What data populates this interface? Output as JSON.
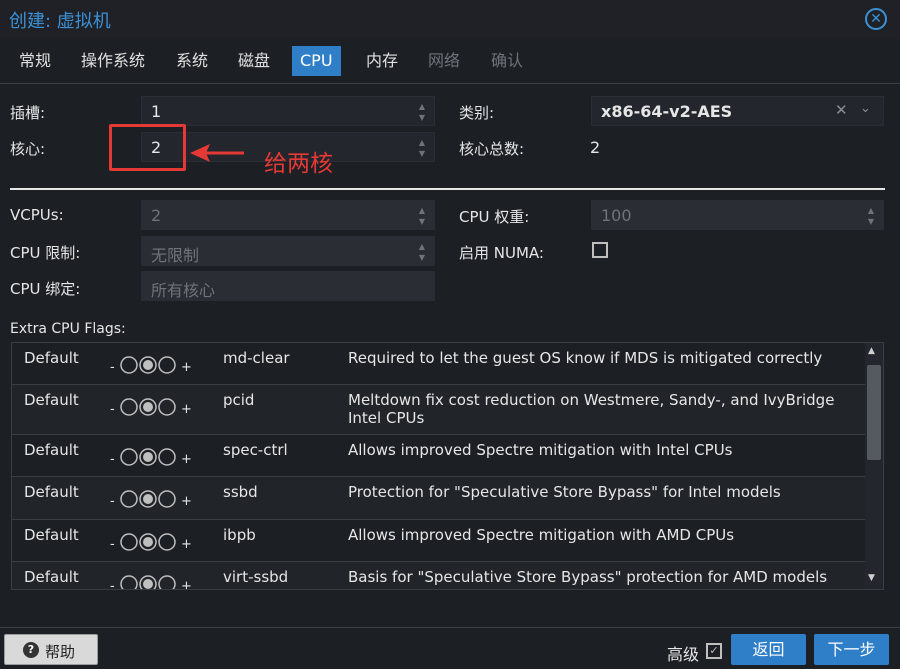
{
  "window": {
    "title": "创建: 虚拟机",
    "close_icon": "close-circle-icon"
  },
  "tabs": [
    {
      "label": "常规",
      "state": "normal"
    },
    {
      "label": "操作系统",
      "state": "normal"
    },
    {
      "label": "系统",
      "state": "normal"
    },
    {
      "label": "磁盘",
      "state": "normal"
    },
    {
      "label": "CPU",
      "state": "active"
    },
    {
      "label": "内存",
      "state": "normal"
    },
    {
      "label": "网络",
      "state": "disabled"
    },
    {
      "label": "确认",
      "state": "disabled"
    }
  ],
  "form": {
    "sockets": {
      "label": "插槽:",
      "value": "1"
    },
    "cores": {
      "label": "核心:",
      "value": "2"
    },
    "type": {
      "label": "类别:",
      "value": "x86-64-v2-AES"
    },
    "total_cores": {
      "label": "核心总数:",
      "value": "2"
    },
    "vcpus": {
      "label": "VCPUs:",
      "value": "2"
    },
    "cpu_limit": {
      "label": "CPU 限制:",
      "placeholder": "无限制"
    },
    "cpu_affinity": {
      "label": "CPU 绑定:",
      "placeholder": "所有核心"
    },
    "cpu_weight": {
      "label": "CPU 权重:",
      "placeholder": "100"
    },
    "numa": {
      "label": "启用 NUMA:",
      "checked": false
    }
  },
  "annotation": {
    "text": "给两核",
    "color": "#e53935"
  },
  "flags": {
    "label": "Extra CPU Flags:",
    "rows": [
      {
        "default": "Default",
        "minus": "-",
        "plus": "+",
        "name": "md-clear",
        "desc": "Required to let the guest OS know if MDS is mitigated correctly"
      },
      {
        "default": "Default",
        "minus": "-",
        "plus": "+",
        "name": "pcid",
        "desc": "Meltdown fix cost reduction on Westmere, Sandy-, and IvyBridge Intel CPUs"
      },
      {
        "default": "Default",
        "minus": "-",
        "plus": "+",
        "name": "spec-ctrl",
        "desc": "Allows improved Spectre mitigation with Intel CPUs"
      },
      {
        "default": "Default",
        "minus": "-",
        "plus": "+",
        "name": "ssbd",
        "desc": "Protection for \"Speculative Store Bypass\" for Intel models"
      },
      {
        "default": "Default",
        "minus": "-",
        "plus": "+",
        "name": "ibpb",
        "desc": "Allows improved Spectre mitigation with AMD CPUs"
      },
      {
        "default": "Default",
        "minus": "-",
        "plus": "+",
        "name": "virt-ssbd",
        "desc": "Basis for \"Speculative Store Bypass\" protection for AMD models"
      }
    ]
  },
  "footer": {
    "help_label": "帮助",
    "advanced_label": "高级",
    "advanced_checked": true,
    "back_label": "返回",
    "next_label": "下一步"
  },
  "colors": {
    "accent": "#2f7fc8",
    "title": "#3c91d6",
    "annotation": "#e53935",
    "background": "#1c1f24"
  }
}
